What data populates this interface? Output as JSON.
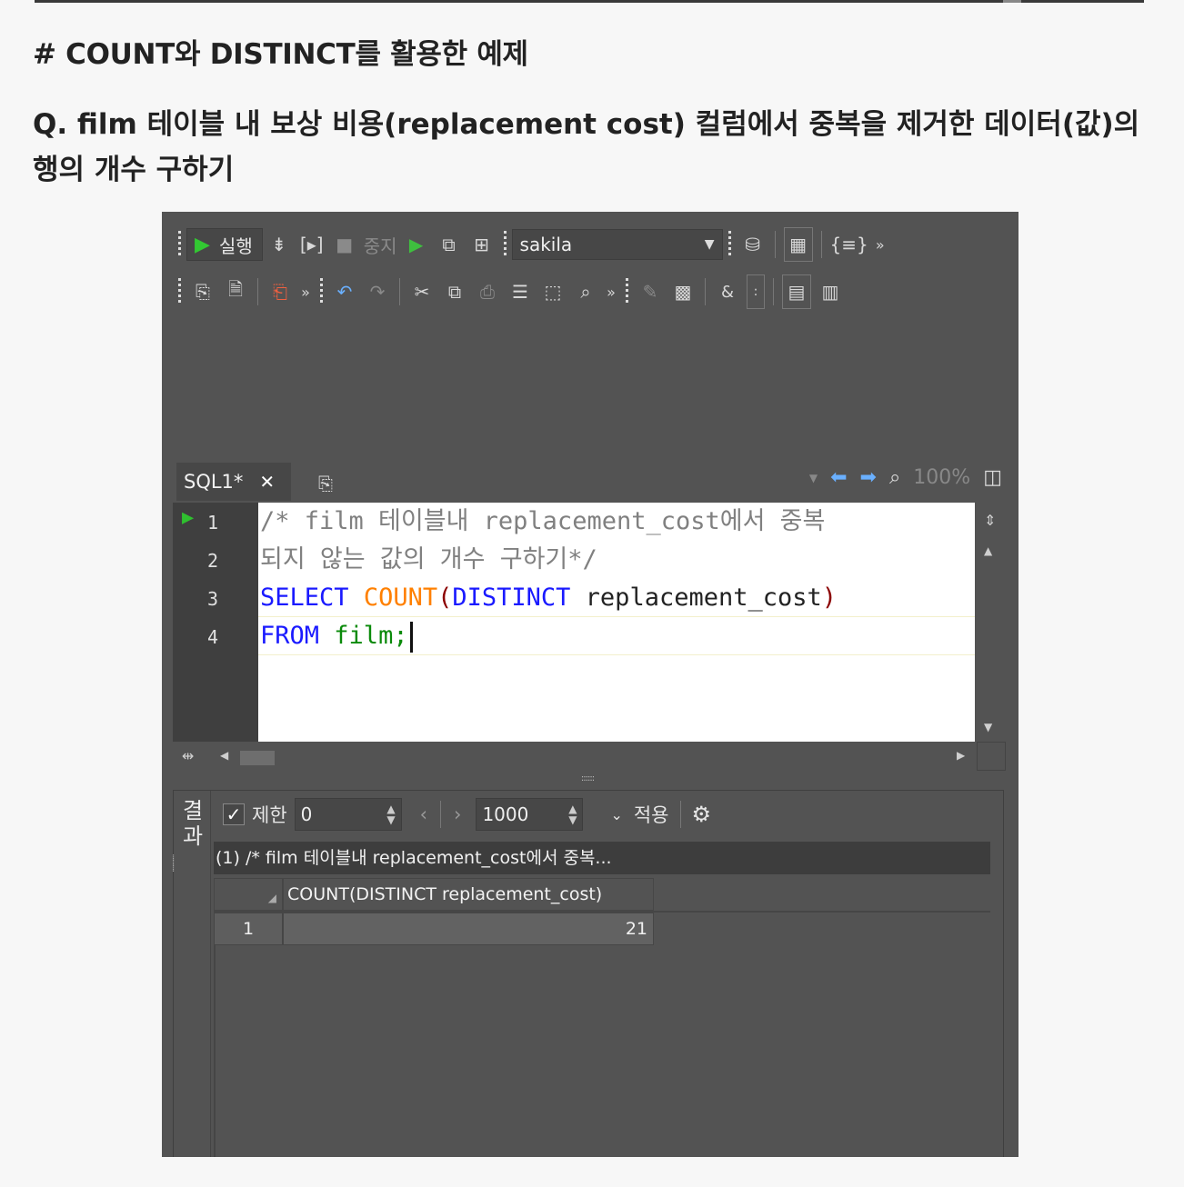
{
  "article": {
    "heading": "# COUNT와 DISTINCT를 활용한 예제",
    "question": "Q. film 테이블 내 보상 비용(replacement cost) 컬럼에서 중복을 제거한 데이터(값)의 행의 개수 구하기"
  },
  "toolbar": {
    "run_label": "실행",
    "stop_label": "중지",
    "database": "sakila",
    "more": "»"
  },
  "tabs": [
    {
      "label": "SQL1*",
      "close": "✕"
    }
  ],
  "editor_controls": {
    "zoom": "100%"
  },
  "editor": {
    "line_numbers": [
      "1",
      "2",
      "3",
      "4"
    ],
    "lines": {
      "l1": "/* film 테이블내 replacement_cost에서 중복",
      "l2": "되지 않는 값의 개수 구하기*/",
      "l3": {
        "kw1": "SELECT",
        "fn": "COUNT",
        "p1": "(",
        "kw2": "DISTINCT",
        "col": "replacement_cost",
        "p2": ")"
      },
      "l4": {
        "kw": "FROM",
        "tbl": "film;"
      }
    }
  },
  "results": {
    "side_label": "결과",
    "limit_label": "제한",
    "limit_checked": true,
    "offset_value": "0",
    "rows_value": "1000",
    "apply_label": "적용",
    "result_title": "(1) /* film 테이블내 replacement_cost에서 중복...",
    "columns": [
      "COUNT(DISTINCT replacement_cost)"
    ],
    "rows": [
      {
        "index": "1",
        "values": [
          "21"
        ]
      }
    ]
  },
  "colors": {
    "ide_background": "#535353",
    "sql_keyword": "#1a1aff",
    "sql_function": "#ff8000",
    "sql_table": "#0a8a0a",
    "sql_comment": "#808080",
    "run_green": "#32c832"
  }
}
